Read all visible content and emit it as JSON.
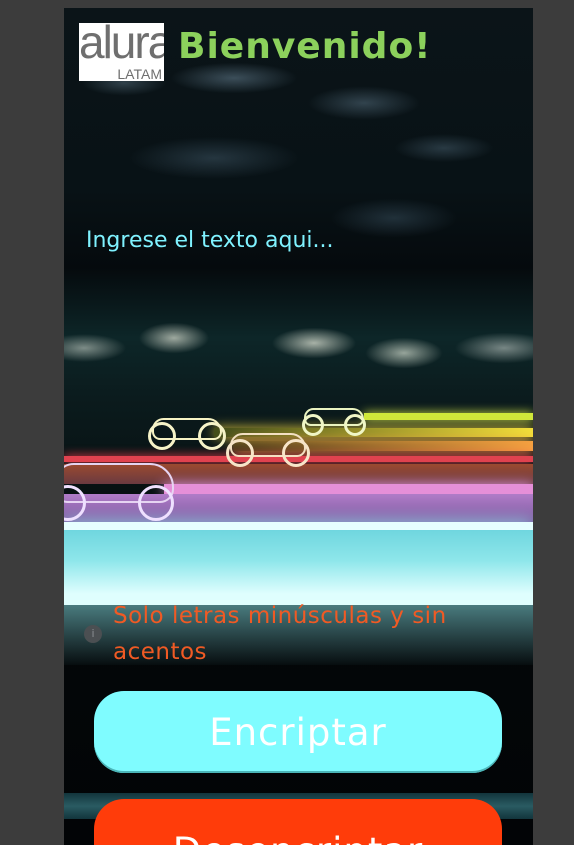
{
  "header": {
    "logo_main": "alura",
    "logo_sub": "LATAM",
    "title": "Bienvenido!"
  },
  "input": {
    "placeholder": "Ingrese el texto aqui..."
  },
  "info": {
    "icon": "info-icon",
    "text": "Solo letras minúsculas y sin acentos"
  },
  "buttons": {
    "encrypt_label": "Encriptar",
    "decrypt_label": "Desencriptar"
  },
  "colors": {
    "title": "#8cd15c",
    "placeholder": "#7ff2ff",
    "info_text": "#f05a24",
    "encrypt_button": "#7ffcff",
    "decrypt_button": "#ff3c0a",
    "page_background": "#3c3c3c"
  }
}
